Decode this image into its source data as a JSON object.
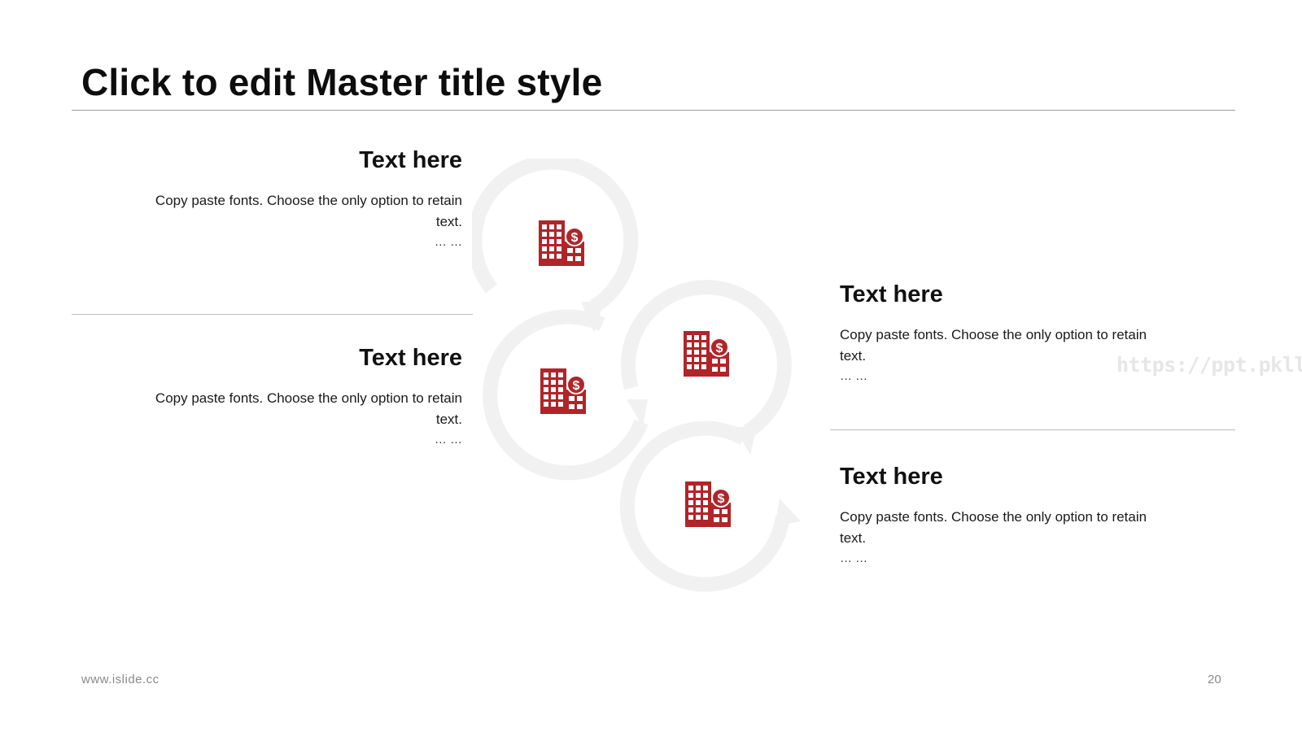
{
  "slide": {
    "title": "Click to edit Master title style",
    "footer_url": "www.islide.cc",
    "page_number": "20",
    "watermark": "https://ppt.pkll.de"
  },
  "blocks": [
    {
      "heading": "Text here",
      "body": "Copy paste fonts. Choose the only option to retain text.",
      "ellipsis": "… …"
    },
    {
      "heading": "Text here",
      "body": "Copy paste fonts. Choose the only option to retain text.",
      "ellipsis": "… …"
    },
    {
      "heading": "Text here",
      "body": "Copy paste fonts. Choose the only option to retain text.",
      "ellipsis": "… …"
    },
    {
      "heading": "Text here",
      "body": "Copy paste fonts. Choose the only option to retain text.",
      "ellipsis": "… …"
    }
  ],
  "diagram": {
    "icon": "building-finance-icon",
    "icon_color": "#b22428",
    "arrow_color": "#f1f1f1"
  }
}
